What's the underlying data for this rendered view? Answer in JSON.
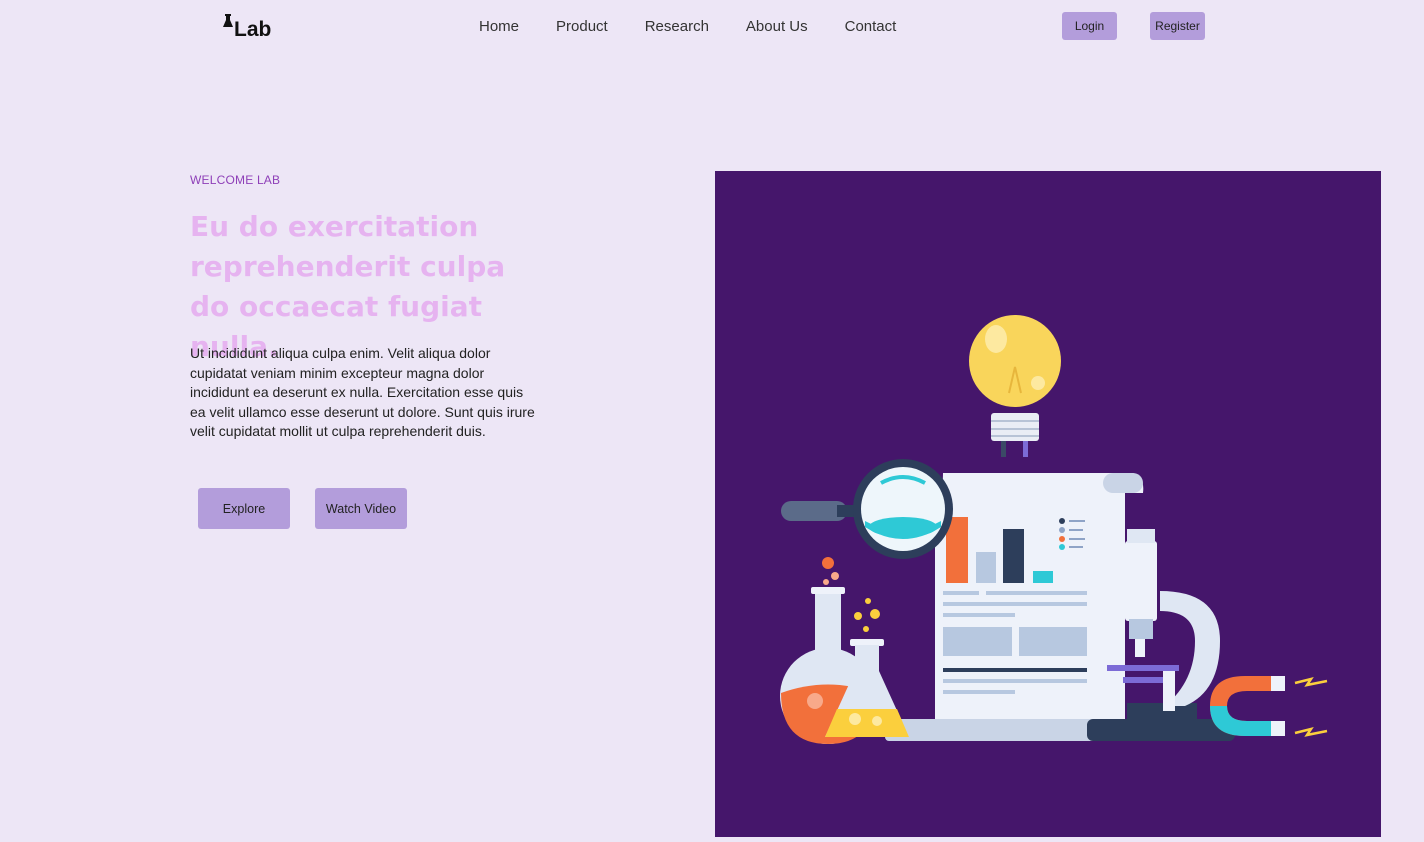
{
  "brand": {
    "name": "Lab",
    "logo_icon": "flask-icon"
  },
  "nav": {
    "links": [
      "Home",
      "Product",
      "Research",
      "About Us",
      "Contact"
    ],
    "login_label": "Login",
    "register_label": "Register"
  },
  "hero": {
    "kicker": "WELCOME LAB",
    "title": "Eu do exercitation reprehenderit culpa do occaecat fugiat nulla.",
    "body": "Ut incididunt aliqua culpa enim. Velit aliqua dolor cupidatat veniam minim excepteur magna dolor incididunt ea deserunt ex nulla. Exercitation esse quis ea velit ullamco esse deserunt ut dolore. Sunt quis irure velit cupidatat mollit ut culpa reprehenderit duis.",
    "explore_label": "Explore",
    "watch_label": "Watch Video"
  },
  "colors": {
    "page_background": "#ede6f6",
    "button": "#b39ddb",
    "kicker": "#8e3fb8",
    "title": "#e6b3f0",
    "illustration_background": "#45166b"
  },
  "illustration": {
    "icons": [
      "light-bulb-icon",
      "magnifying-glass-icon",
      "report-document-icon",
      "round-flask-icon",
      "erlenmeyer-flask-icon",
      "microscope-icon",
      "magnet-icon"
    ]
  }
}
